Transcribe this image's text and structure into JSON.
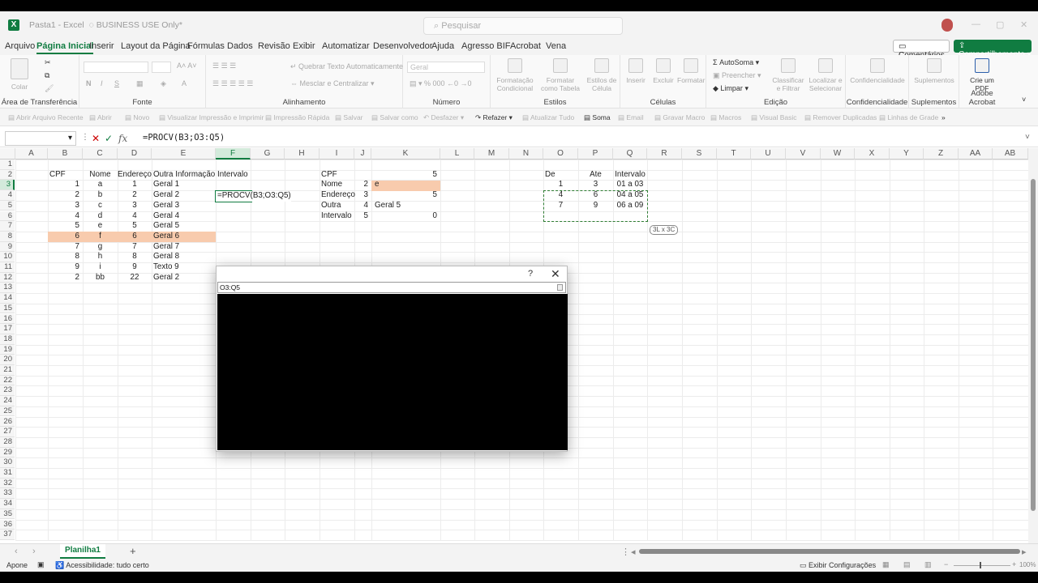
{
  "title": {
    "book": "Pasta1",
    "app": "Excel",
    "label": "BUSINESS USE Only*"
  },
  "search": {
    "placeholder": "Pesquisar"
  },
  "menu": [
    "Arquivo",
    "Página Inicial",
    "Inserir",
    "Layout da Página",
    "Fórmulas",
    "Dados",
    "Revisão",
    "Exibir",
    "Automatizar",
    "Desenvolvedor",
    "Ajuda",
    "Agresso BIF",
    "Acrobat",
    "Vena"
  ],
  "comments_label": "Comentários",
  "share_label": "Compartilhamento",
  "ribbon": {
    "groups": [
      "Área de Transferência",
      "Fonte",
      "Alinhamento",
      "Número",
      "Estilos",
      "Células",
      "Edição",
      "Confidencialidade",
      "Suplementos",
      "Adobe Acrobat"
    ],
    "colar": "Colar",
    "quebrar": "Quebrar Texto Automaticamente",
    "mesclar": "Mesclar e Centralizar",
    "numfmt": "Geral",
    "formatacao": "Formatação Condicional",
    "formatar_tabela": "Formatar como Tabela",
    "estilos_celula": "Estilos de Célula",
    "inserir": "Inserir",
    "excluir": "Excluir",
    "formatar": "Formatar",
    "autosoma": "AutoSoma",
    "preencher": "Preencher",
    "limpar": "Limpar",
    "classificar": "Classificar e Filtrar",
    "localizar": "Localizar e Selecionar",
    "confid": "Confidencialidade",
    "suplementos": "Suplementos",
    "crie_pdf": "Crie um PDF"
  },
  "qat": [
    "Abrir Arquivo Recente",
    "Abrir",
    "Novo",
    "Visualizar Impressão e Imprimir",
    "Impressão Rápida",
    "Salvar",
    "Salvar como",
    "Desfazer",
    "Refazer",
    "Atualizar Tudo",
    "Soma",
    "Email",
    "Gravar Macro",
    "Macros",
    "Visual Basic",
    "Remover Duplicadas",
    "Linhas de Grade"
  ],
  "formula_bar": {
    "name_box": "",
    "formula": "=PROCV(B3;O3:Q5)"
  },
  "columns": [
    "A",
    "B",
    "C",
    "D",
    "E",
    "F",
    "G",
    "H",
    "I",
    "J",
    "K",
    "L",
    "M",
    "N",
    "O",
    "P",
    "Q",
    "R",
    "S",
    "T",
    "U",
    "V",
    "W",
    "X",
    "Y",
    "Z",
    "AA",
    "AB"
  ],
  "rows": [
    1,
    2,
    3,
    4,
    5,
    6,
    7,
    8,
    9,
    10,
    11,
    12,
    13,
    14,
    15,
    16,
    17,
    18,
    19,
    20,
    21,
    22,
    23,
    24,
    25,
    26,
    27,
    28,
    29,
    30,
    31,
    32,
    33,
    34,
    35,
    36,
    37
  ],
  "table1": {
    "headers": [
      "CPF",
      "Nome",
      "Endereço",
      "Outra Informação",
      "Intervalo"
    ],
    "rows": [
      [
        "1",
        "a",
        "1",
        "Geral 1"
      ],
      [
        "2",
        "b",
        "2",
        "Geral 2"
      ],
      [
        "3",
        "c",
        "3",
        "Geral 3"
      ],
      [
        "4",
        "d",
        "4",
        "Geral 4"
      ],
      [
        "5",
        "e",
        "5",
        "Geral 5"
      ],
      [
        "6",
        "f",
        "6",
        "Geral 6"
      ],
      [
        "7",
        "g",
        "7",
        "Geral 7"
      ],
      [
        "8",
        "h",
        "8",
        "Geral 8"
      ],
      [
        "9",
        "i",
        "9",
        "Texto 9"
      ],
      [
        "2",
        "bb",
        "22",
        "Geral 2"
      ]
    ],
    "editing_formula": "=PROCV(B3;O3:Q5)"
  },
  "lookup": {
    "cpf_label": "CPF",
    "cpf_value": "5",
    "rows": [
      {
        "label": "Nome",
        "j": "2",
        "k": "e"
      },
      {
        "label": "Endereço",
        "j": "3",
        "k": "5"
      },
      {
        "label": "Outra",
        "j": "4",
        "k": "Geral 5"
      },
      {
        "label": "Intervalo",
        "j": "5",
        "k": "0"
      }
    ]
  },
  "table2": {
    "headers": [
      "De",
      "Ate",
      "Intervalo"
    ],
    "rows": [
      [
        "1",
        "3",
        "01 a 03"
      ],
      [
        "4",
        "6",
        "04 a 05"
      ],
      [
        "7",
        "9",
        "06 a 09"
      ]
    ],
    "size_tip": "3L x 3C"
  },
  "dialog": {
    "help": "?",
    "close": "✕",
    "input": "O3:Q5"
  },
  "sheet_tab": "Planilha1",
  "status": {
    "mode": "Apone",
    "accessibility": "Acessibilidade: tudo certo",
    "display": "Exibir Configurações",
    "zoom": "100%"
  }
}
